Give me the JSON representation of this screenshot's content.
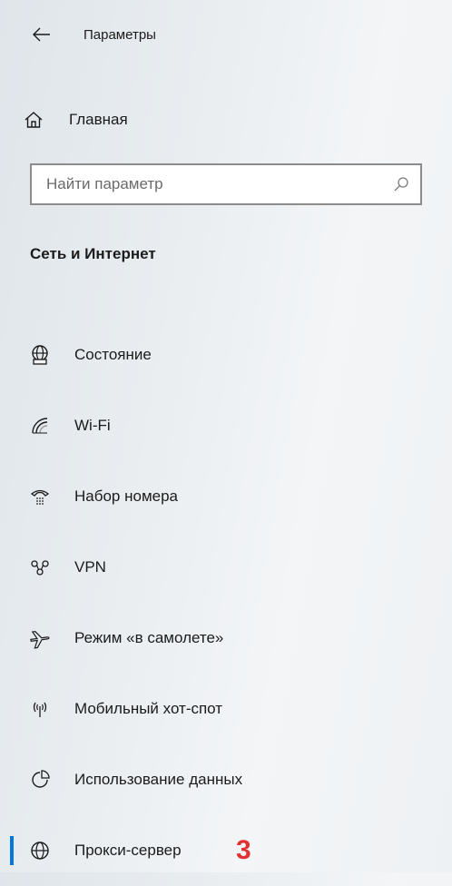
{
  "header": {
    "title": "Параметры",
    "back_icon": "arrow-left-icon"
  },
  "home": {
    "label": "Главная",
    "icon": "home-icon"
  },
  "search": {
    "placeholder": "Найти параметр",
    "value": "",
    "icon": "search-icon"
  },
  "section": {
    "title": "Сеть и Интернет"
  },
  "nav": {
    "items": [
      {
        "label": "Состояние",
        "icon": "globe-status-icon",
        "selected": false
      },
      {
        "label": "Wi-Fi",
        "icon": "wifi-icon",
        "selected": false
      },
      {
        "label": "Набор номера",
        "icon": "dial-up-icon",
        "selected": false
      },
      {
        "label": "VPN",
        "icon": "vpn-icon",
        "selected": false
      },
      {
        "label": "Режим «в самолете»",
        "icon": "airplane-icon",
        "selected": false
      },
      {
        "label": "Мобильный хот-спот",
        "icon": "hotspot-icon",
        "selected": false
      },
      {
        "label": "Использование данных",
        "icon": "data-usage-icon",
        "selected": false
      },
      {
        "label": "Прокси-сервер",
        "icon": "proxy-globe-icon",
        "selected": true
      }
    ]
  },
  "annotation": {
    "marker": "3"
  },
  "colors": {
    "accent": "#0078d7",
    "annotation": "#e03232",
    "text": "#1b1b1b"
  }
}
